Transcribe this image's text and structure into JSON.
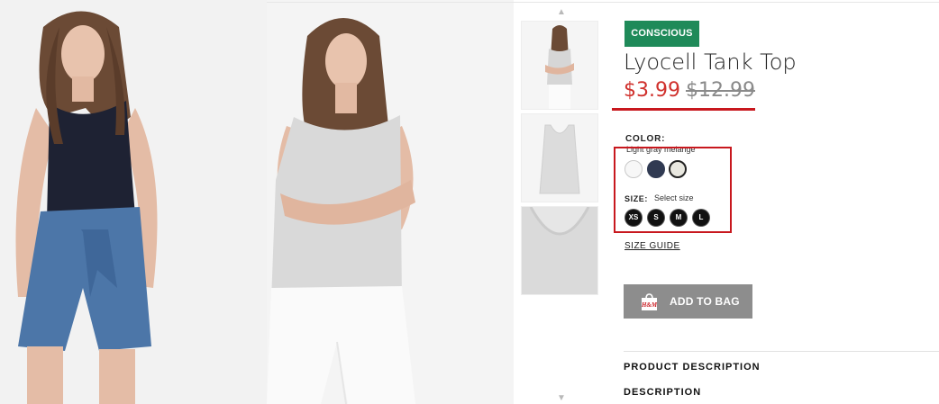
{
  "product": {
    "badge": "CONSCIOUS",
    "title": "Lyocell Tank Top",
    "sale_price": "$3.99",
    "original_price": "$12.99"
  },
  "color": {
    "label": "COLOR:",
    "selected_name": "Light gray melange",
    "swatches": [
      {
        "name": "white",
        "hex": "#f7f7f7"
      },
      {
        "name": "dark blue",
        "hex": "#303a52"
      },
      {
        "name": "light gray melange",
        "hex": "#e9e8e0"
      }
    ]
  },
  "size": {
    "label": "SIZE:",
    "prompt": "Select size",
    "options": [
      "XS",
      "S",
      "M",
      "L"
    ]
  },
  "size_guide": "SIZE GUIDE",
  "add_to_bag": {
    "label": "ADD TO BAG",
    "icon_text": "H&M"
  },
  "sections": {
    "product_description": "PRODUCT DESCRIPTION",
    "description": "DESCRIPTION"
  },
  "colors": {
    "badge_green": "#1f8a59",
    "sale_red": "#d0312d",
    "highlight_red": "#c8181e",
    "button_gray": "#8d8d8d"
  }
}
